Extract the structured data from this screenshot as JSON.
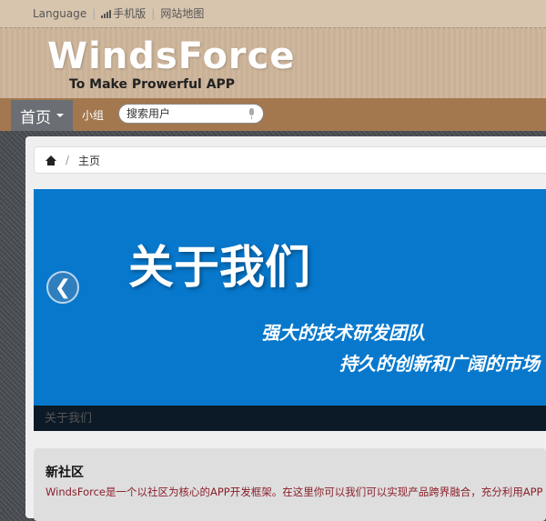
{
  "topbar": {
    "language": "Language",
    "mobile": "手机版",
    "sitemap": "网站地图"
  },
  "header": {
    "logo": "WindsForce",
    "slogan": "To Make Prowerful APP"
  },
  "nav": {
    "home": "首页",
    "group": "小组",
    "search_placeholder": "搜索用户"
  },
  "breadcrumb": {
    "current": "主页"
  },
  "banner": {
    "title": "关于我们",
    "line1": "强大的技术研发团队",
    "line2": "持久的创新和广阔的市场",
    "caption": "关于我们",
    "prev_symbol": "❮"
  },
  "news": {
    "title": "新社区",
    "text": "WindsForce是一个以社区为核心的APP开发框架。在这里你可以我们可以实现产品跨界融合，充分利用APP"
  },
  "colors": {
    "banner": "#0778cc",
    "navbar": "#a3784f",
    "header": "#cdb59a",
    "nav_active": "#6b6f75"
  }
}
